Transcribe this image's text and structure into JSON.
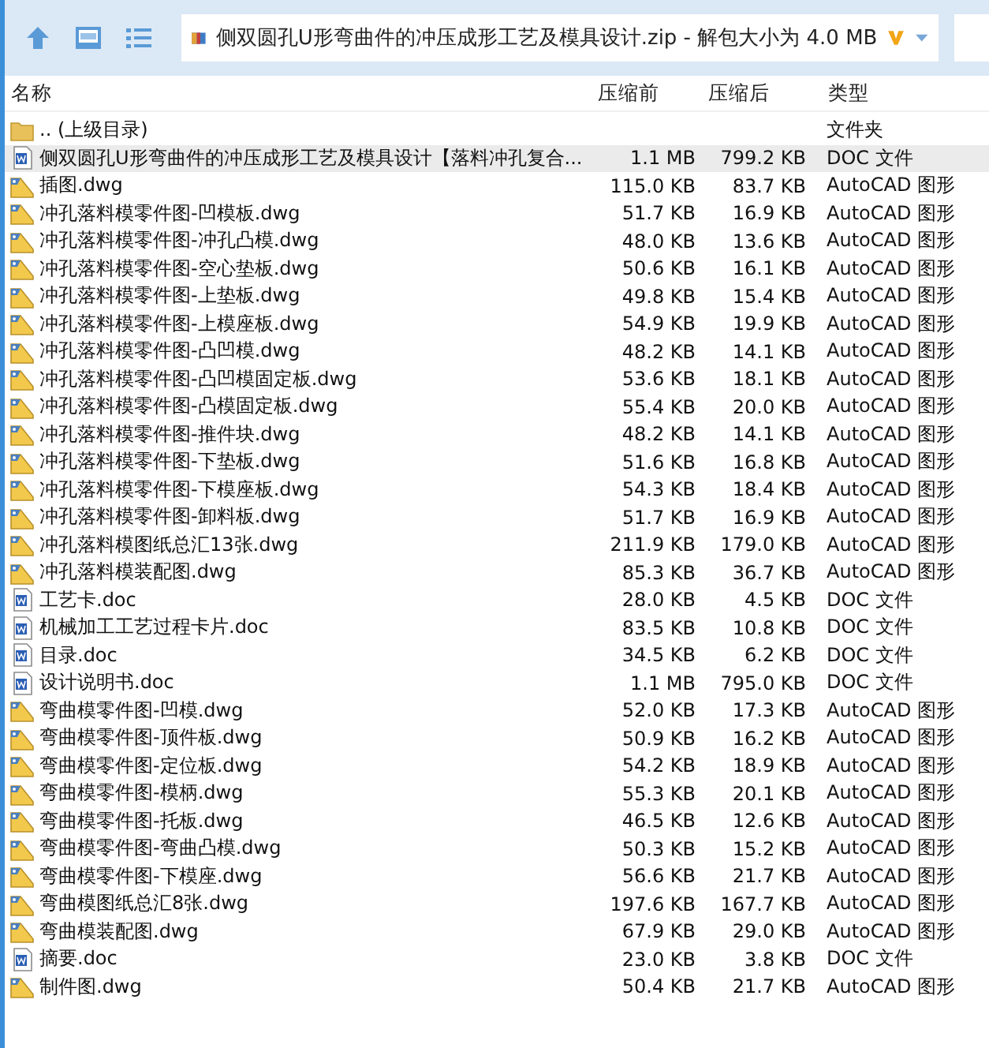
{
  "address_bar": {
    "path": "侧双圆孔U形弯曲件的冲压成形工艺及模具设计.zip - 解包大小为 4.0 MB"
  },
  "columns": [
    "名称",
    "压缩前",
    "压缩后",
    "类型"
  ],
  "rows": [
    {
      "kind": "parent",
      "name": ".. (上级目录)",
      "size": "",
      "packed": "",
      "type": "文件夹",
      "selected": false
    },
    {
      "kind": "doc",
      "name": "侧双圆孔U形弯曲件的冲压成形工艺及模具设计【落料冲孔复合...",
      "size": "1.1 MB",
      "packed": "799.2 KB",
      "type": "DOC 文件",
      "selected": true
    },
    {
      "kind": "dwg",
      "name": "插图.dwg",
      "size": "115.0 KB",
      "packed": "83.7 KB",
      "type": "AutoCAD 图形",
      "selected": false
    },
    {
      "kind": "dwg",
      "name": "冲孔落料模零件图-凹模板.dwg",
      "size": "51.7 KB",
      "packed": "16.9 KB",
      "type": "AutoCAD 图形",
      "selected": false
    },
    {
      "kind": "dwg",
      "name": "冲孔落料模零件图-冲孔凸模.dwg",
      "size": "48.0 KB",
      "packed": "13.6 KB",
      "type": "AutoCAD 图形",
      "selected": false
    },
    {
      "kind": "dwg",
      "name": "冲孔落料模零件图-空心垫板.dwg",
      "size": "50.6 KB",
      "packed": "16.1 KB",
      "type": "AutoCAD 图形",
      "selected": false
    },
    {
      "kind": "dwg",
      "name": "冲孔落料模零件图-上垫板.dwg",
      "size": "49.8 KB",
      "packed": "15.4 KB",
      "type": "AutoCAD 图形",
      "selected": false
    },
    {
      "kind": "dwg",
      "name": "冲孔落料模零件图-上模座板.dwg",
      "size": "54.9 KB",
      "packed": "19.9 KB",
      "type": "AutoCAD 图形",
      "selected": false
    },
    {
      "kind": "dwg",
      "name": "冲孔落料模零件图-凸凹模.dwg",
      "size": "48.2 KB",
      "packed": "14.1 KB",
      "type": "AutoCAD 图形",
      "selected": false
    },
    {
      "kind": "dwg",
      "name": "冲孔落料模零件图-凸凹模固定板.dwg",
      "size": "53.6 KB",
      "packed": "18.1 KB",
      "type": "AutoCAD 图形",
      "selected": false
    },
    {
      "kind": "dwg",
      "name": "冲孔落料模零件图-凸模固定板.dwg",
      "size": "55.4 KB",
      "packed": "20.0 KB",
      "type": "AutoCAD 图形",
      "selected": false
    },
    {
      "kind": "dwg",
      "name": "冲孔落料模零件图-推件块.dwg",
      "size": "48.2 KB",
      "packed": "14.1 KB",
      "type": "AutoCAD 图形",
      "selected": false
    },
    {
      "kind": "dwg",
      "name": "冲孔落料模零件图-下垫板.dwg",
      "size": "51.6 KB",
      "packed": "16.8 KB",
      "type": "AutoCAD 图形",
      "selected": false
    },
    {
      "kind": "dwg",
      "name": "冲孔落料模零件图-下模座板.dwg",
      "size": "54.3 KB",
      "packed": "18.4 KB",
      "type": "AutoCAD 图形",
      "selected": false
    },
    {
      "kind": "dwg",
      "name": "冲孔落料模零件图-卸料板.dwg",
      "size": "51.7 KB",
      "packed": "16.9 KB",
      "type": "AutoCAD 图形",
      "selected": false
    },
    {
      "kind": "dwg",
      "name": "冲孔落料模图纸总汇13张.dwg",
      "size": "211.9 KB",
      "packed": "179.0 KB",
      "type": "AutoCAD 图形",
      "selected": false
    },
    {
      "kind": "dwg",
      "name": "冲孔落料模装配图.dwg",
      "size": "85.3 KB",
      "packed": "36.7 KB",
      "type": "AutoCAD 图形",
      "selected": false
    },
    {
      "kind": "doc",
      "name": "工艺卡.doc",
      "size": "28.0 KB",
      "packed": "4.5 KB",
      "type": "DOC 文件",
      "selected": false
    },
    {
      "kind": "doc",
      "name": "机械加工工艺过程卡片.doc",
      "size": "83.5 KB",
      "packed": "10.8 KB",
      "type": "DOC 文件",
      "selected": false
    },
    {
      "kind": "doc",
      "name": "目录.doc",
      "size": "34.5 KB",
      "packed": "6.2 KB",
      "type": "DOC 文件",
      "selected": false
    },
    {
      "kind": "doc",
      "name": "设计说明书.doc",
      "size": "1.1 MB",
      "packed": "795.0 KB",
      "type": "DOC 文件",
      "selected": false
    },
    {
      "kind": "dwg",
      "name": "弯曲模零件图-凹模.dwg",
      "size": "52.0 KB",
      "packed": "17.3 KB",
      "type": "AutoCAD 图形",
      "selected": false
    },
    {
      "kind": "dwg",
      "name": "弯曲模零件图-顶件板.dwg",
      "size": "50.9 KB",
      "packed": "16.2 KB",
      "type": "AutoCAD 图形",
      "selected": false
    },
    {
      "kind": "dwg",
      "name": "弯曲模零件图-定位板.dwg",
      "size": "54.2 KB",
      "packed": "18.9 KB",
      "type": "AutoCAD 图形",
      "selected": false
    },
    {
      "kind": "dwg",
      "name": "弯曲模零件图-模柄.dwg",
      "size": "55.3 KB",
      "packed": "20.1 KB",
      "type": "AutoCAD 图形",
      "selected": false
    },
    {
      "kind": "dwg",
      "name": "弯曲模零件图-托板.dwg",
      "size": "46.5 KB",
      "packed": "12.6 KB",
      "type": "AutoCAD 图形",
      "selected": false
    },
    {
      "kind": "dwg",
      "name": "弯曲模零件图-弯曲凸模.dwg",
      "size": "50.3 KB",
      "packed": "15.2 KB",
      "type": "AutoCAD 图形",
      "selected": false
    },
    {
      "kind": "dwg",
      "name": "弯曲模零件图-下模座.dwg",
      "size": "56.6 KB",
      "packed": "21.7 KB",
      "type": "AutoCAD 图形",
      "selected": false
    },
    {
      "kind": "dwg",
      "name": "弯曲模图纸总汇8张.dwg",
      "size": "197.6 KB",
      "packed": "167.7 KB",
      "type": "AutoCAD 图形",
      "selected": false
    },
    {
      "kind": "dwg",
      "name": "弯曲模装配图.dwg",
      "size": "67.9 KB",
      "packed": "29.0 KB",
      "type": "AutoCAD 图形",
      "selected": false
    },
    {
      "kind": "doc",
      "name": "摘要.doc",
      "size": "23.0 KB",
      "packed": "3.8 KB",
      "type": "DOC 文件",
      "selected": false
    },
    {
      "kind": "dwg",
      "name": "制件图.dwg",
      "size": "50.4 KB",
      "packed": "21.7 KB",
      "type": "AutoCAD 图形",
      "selected": false
    }
  ]
}
